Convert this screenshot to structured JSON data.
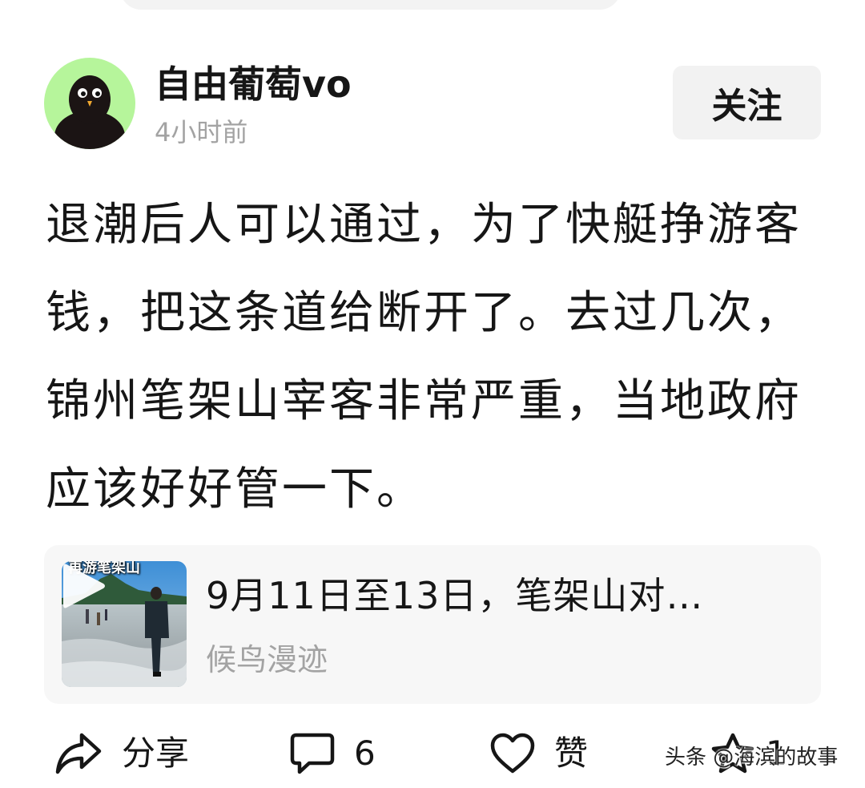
{
  "author": {
    "name": "自由葡萄vo",
    "time": "4小时前"
  },
  "follow_label": "关注",
  "post": {
    "text": "退潮后人可以通过，为了快艇挣游客钱，把这条道给断开了。去过几次，锦州笔架山宰客非常严重，当地政府应该好好管一下。"
  },
  "linked_video": {
    "thumb_caption": "再游笔架山",
    "title": "9月11日至13日，笔架山对…",
    "source": "候鸟漫迹"
  },
  "actions": {
    "share_label": "分享",
    "comment_count": "6",
    "like_label": "赞",
    "favorite_count": "1"
  },
  "watermark": "头条 @海滨的故事",
  "icons": [
    "share-icon",
    "comment-icon",
    "heart-icon",
    "star-icon",
    "play-icon"
  ],
  "colors": {
    "avatar_bg": "#b6f59b",
    "secondary_text": "#a3a3a3",
    "button_bg": "#f2f2f2",
    "card_bg": "#f7f7f7"
  }
}
